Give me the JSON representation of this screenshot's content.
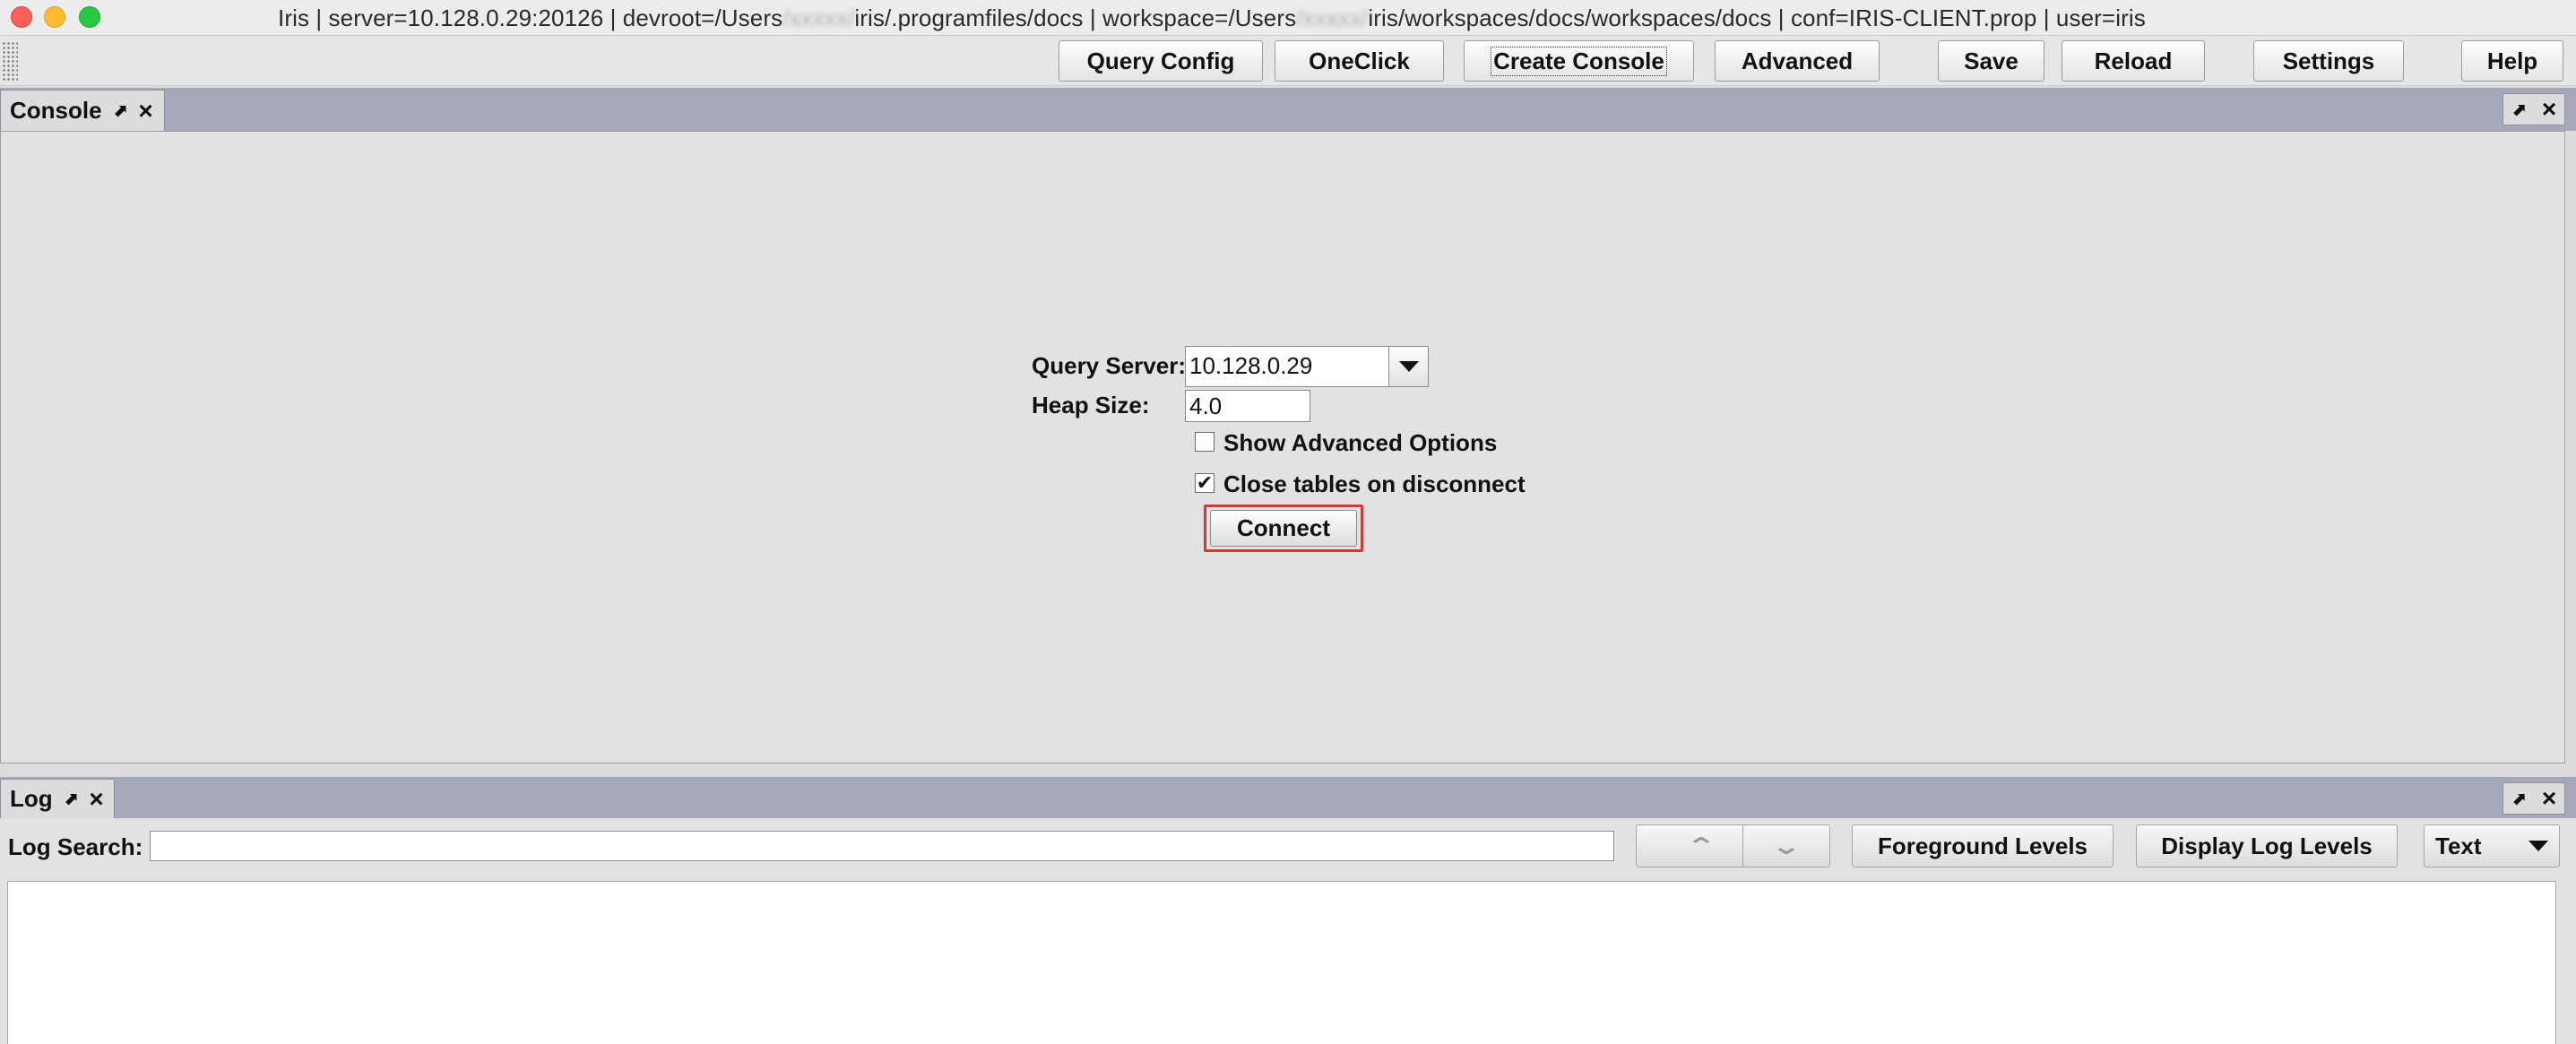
{
  "window": {
    "title_prefix": "Iris  | server=10.128.0.29:20126 | devroot=/Users",
    "blurred_user_1": "/xxxxx/",
    "title_middle_1": "iris/.programfiles/docs | workspace=/Users",
    "blurred_user_2": "/xxxxx/",
    "title_suffix": "iris/workspaces/docs/workspaces/docs | conf=IRIS-CLIENT.prop | user=iris"
  },
  "toolbar": {
    "query_config": "Query Config",
    "oneclick": "OneClick",
    "create_console": "Create Console",
    "advanced": "Advanced",
    "save": "Save",
    "reload": "Reload",
    "settings": "Settings",
    "help": "Help"
  },
  "console": {
    "tab_label": "Console",
    "query_server_label": "Query Server:",
    "query_server_value": "10.128.0.29",
    "heap_size_label": "Heap Size:",
    "heap_size_value": "4.0",
    "show_advanced_label": "Show Advanced Options",
    "show_advanced_checked": false,
    "close_tables_label": "Close tables on disconnect",
    "close_tables_checked": true,
    "connect_label": "Connect"
  },
  "log": {
    "tab_label": "Log",
    "search_label": "Log Search:",
    "search_value": "",
    "foreground_levels": "Foreground Levels",
    "display_log_levels": "Display Log Levels",
    "format_value": "Text"
  },
  "icons": {
    "pin": "pin-icon",
    "close": "close-icon",
    "dropdown": "chevron-down-icon"
  },
  "colors": {
    "tabstrip": "#a5a8b8",
    "highlight": "#d33a2a"
  }
}
